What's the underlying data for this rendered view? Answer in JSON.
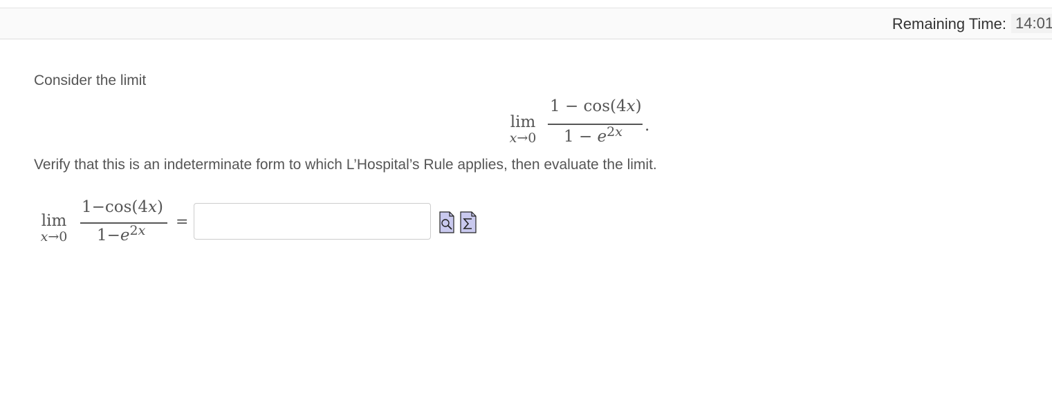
{
  "timer": {
    "label": "Remaining Time:",
    "value": "14:01"
  },
  "question": {
    "intro": "Consider the limit",
    "instruction": "Verify that this is an indeterminate form to which L’Hospital’s Rule applies, then evaluate the limit.",
    "display_limit": {
      "operator": "lim",
      "subscript": "x→0",
      "numerator": "1 − cos(4x)",
      "denominator": "1 − e^{2x}",
      "trailing": "."
    },
    "answer_limit": {
      "operator": "lim",
      "subscript": "x→0",
      "numerator": "1−cos(4x)",
      "denominator": "1−e^{2x}",
      "equals": "="
    },
    "answer_input": {
      "value": "",
      "placeholder": ""
    },
    "tools": [
      {
        "name": "preview-icon",
        "label": "Preview"
      },
      {
        "name": "equation-editor-icon",
        "label": "Σ"
      }
    ]
  },
  "colors": {
    "text": "#555555",
    "timer_bg": "#fafafa",
    "icon_fill": "#c9c9ee",
    "icon_stroke": "#222222"
  }
}
